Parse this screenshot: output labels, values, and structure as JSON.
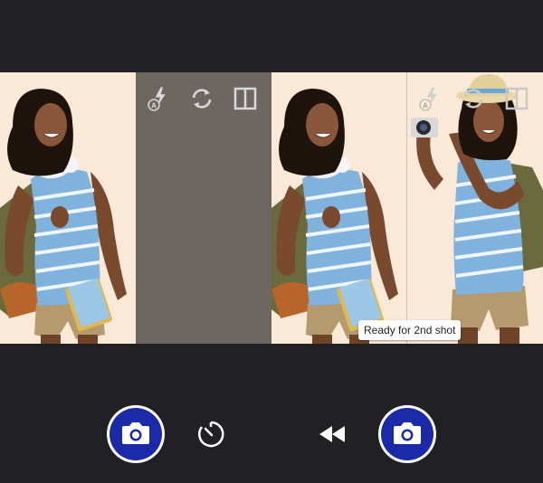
{
  "camera": {
    "left_panel": {
      "toolbar": [
        {
          "icon": "flash-auto-icon"
        },
        {
          "icon": "switch-camera-icon"
        },
        {
          "icon": "split-layout-icon"
        }
      ]
    },
    "right_panel": {
      "toolbar": [
        {
          "icon": "flash-auto-icon"
        },
        {
          "icon": "switch-camera-icon"
        },
        {
          "icon": "split-layout-icon"
        }
      ]
    },
    "toast": "Ready for 2nd shot",
    "bottom_controls": [
      {
        "icon": "camera-icon"
      },
      {
        "icon": "timer-icon"
      },
      {
        "icon": "rewind-icon"
      },
      {
        "icon": "camera-icon"
      }
    ]
  },
  "colors": {
    "background": "#212125",
    "shutter": "#1b2aa8",
    "photo_background": "#fbe9d7",
    "gray_half": "#6e6761"
  }
}
